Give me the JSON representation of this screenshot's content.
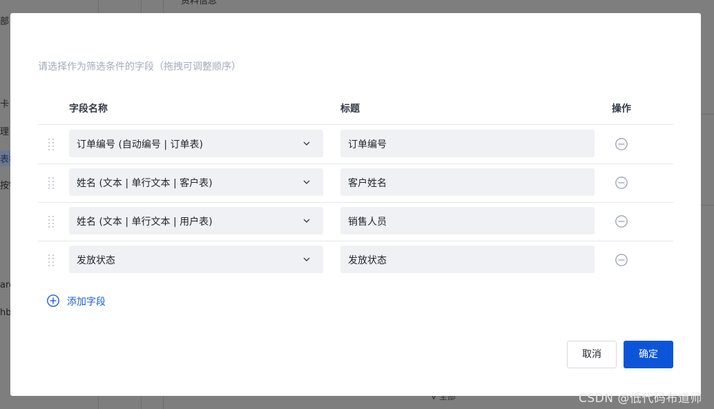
{
  "background": {
    "top_fragment": "资料信息",
    "left_fragments": [
      "部",
      "卡",
      "理",
      "表格",
      "按钮",
      "ard",
      "hb"
    ],
    "bottom_fragment": "ᐯ 全部"
  },
  "dialog": {
    "hint": "请选择作为筛选条件的字段（拖拽可调整顺序）",
    "columns": {
      "field_name": "字段名称",
      "title": "标题",
      "action": "操作"
    },
    "rows": [
      {
        "field": "订单编号 (自动编号 | 订单表)",
        "title": "订单编号"
      },
      {
        "field": "姓名 (文本 | 单行文本 | 客户表)",
        "title": "客户姓名"
      },
      {
        "field": "姓名 (文本 | 单行文本 | 用户表)",
        "title": "销售人员"
      },
      {
        "field": "发放状态",
        "title": "发放状态"
      }
    ],
    "add_field_label": "添加字段",
    "cancel_label": "取消",
    "confirm_label": "确定"
  },
  "icons": {
    "drag_handle": "drag-handle-icon",
    "dropdown": "chevron-down-icon",
    "remove": "minus-circle-icon",
    "add": "plus-circle-icon"
  },
  "colors": {
    "primary": "#0d55d8",
    "link": "#1a5fd0",
    "field_bg": "#f0f1f4",
    "overlay": "#7e7e7e",
    "hint_text": "#a3acb9"
  },
  "watermark": "CSDN @低代码布道师"
}
